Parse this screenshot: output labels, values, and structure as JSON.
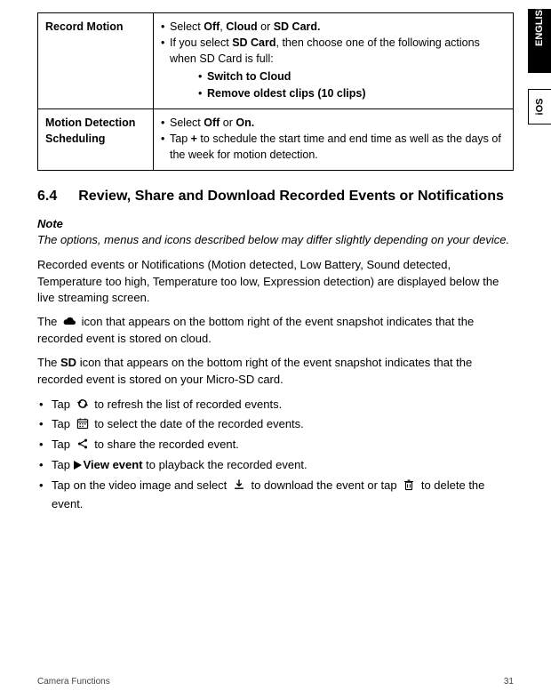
{
  "tabs": {
    "english": "ENGLISH",
    "ios": "iOS"
  },
  "table": {
    "row1": {
      "label": "Record Motion",
      "b1_pre": "Select ",
      "b1_strong": "Off",
      "b1_mid1": ", ",
      "b1_strong2": "Cloud",
      "b1_mid2": " or ",
      "b1_strong3": "SD Card.",
      "b2_pre": "If you select ",
      "b2_strong": "SD Card",
      "b2_post": ", then choose one of the following actions when SD Card is full:",
      "sub1": "Switch to Cloud",
      "sub2": "Remove oldest clips (10 clips)"
    },
    "row2": {
      "label": "Motion Detection Scheduling",
      "b1_pre": "Select ",
      "b1_strong": "Off",
      "b1_mid": " or ",
      "b1_strong2": "On.",
      "b2_pre": "Tap ",
      "b2_strong": "+",
      "b2_post": " to schedule the start time and end time as well as the days of the week for motion detection."
    }
  },
  "heading": {
    "num": "6.4",
    "title": "Review, Share and Download Recorded Events or Notifications"
  },
  "note": {
    "label": "Note",
    "text": "The options, menus and icons described below may differ slightly depending on your device."
  },
  "p1": "Recorded events or Notifications (Motion detected, Low Battery, Sound detected, Temperature too high, Temperature too low, Expression detection) are displayed below the live streaming screen.",
  "pcloud_pre": "The ",
  "pcloud_post": " icon that appears on the bottom right of the event snapshot indicates that the recorded event is stored on cloud.",
  "psd_pre": "The ",
  "psd_strong": "SD",
  "psd_post": " icon that appears on the bottom right of the event snapshot indicates that the recorded event is stored on your Micro-SD card.",
  "actions": {
    "refresh_pre": "Tap ",
    "refresh_post": " to refresh the list of recorded events.",
    "date_pre": "Tap ",
    "date_post": " to select the date of the recorded events.",
    "share_pre": "Tap ",
    "share_post": " to share the recorded event.",
    "view_pre": "Tap ",
    "view_strong": "View event",
    "view_post": " to playback the recorded event.",
    "dl_pre": "Tap on the video image and select ",
    "dl_mid": " to download the event or tap ",
    "dl_post": " to delete the event."
  },
  "footer": {
    "left": "Camera Functions",
    "right": "31"
  }
}
